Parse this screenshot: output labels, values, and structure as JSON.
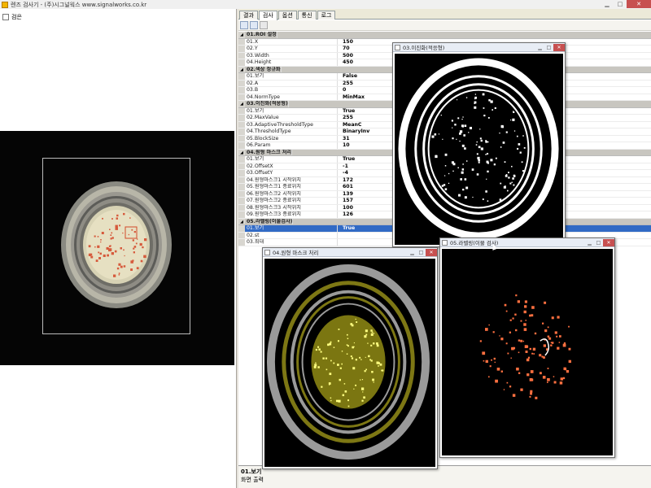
{
  "window": {
    "title": "렌즈 검사기 - (주)시그널웍스 www.signalworks.co.kr"
  },
  "left": {
    "checkbox_label": "검은"
  },
  "tabs": [
    "결과",
    "검사",
    "옵션",
    "통신",
    "로그"
  ],
  "property_grid": {
    "categories": [
      {
        "label": "01.ROI 설정",
        "rows": [
          {
            "name": "01.X",
            "value": "150"
          },
          {
            "name": "02.Y",
            "value": "70"
          },
          {
            "name": "03.Width",
            "value": "500"
          },
          {
            "name": "04.Height",
            "value": "450"
          }
        ]
      },
      {
        "label": "02.색상 정규화",
        "rows": [
          {
            "name": "01.보기",
            "value": "False"
          },
          {
            "name": "02.A",
            "value": "255"
          },
          {
            "name": "03.B",
            "value": "0"
          },
          {
            "name": "04.NormType",
            "value": "MinMax"
          }
        ]
      },
      {
        "label": "03.이진화(적응형)",
        "rows": [
          {
            "name": "01.보기",
            "value": "True"
          },
          {
            "name": "02.MaxValue",
            "value": "255"
          },
          {
            "name": "03.AdaptiveThresholdType",
            "value": "MeanC"
          },
          {
            "name": "04.ThresholdType",
            "value": "BinaryInv"
          },
          {
            "name": "05.BlockSize",
            "value": "31"
          },
          {
            "name": "06.Param",
            "value": "10"
          }
        ]
      },
      {
        "label": "04.원형 마스크 처리",
        "rows": [
          {
            "name": "01.보기",
            "value": "True"
          },
          {
            "name": "02.OffsetX",
            "value": "-1"
          },
          {
            "name": "03.OffsetY",
            "value": "-4"
          },
          {
            "name": "04.원형마스크1 시작위치",
            "value": "172"
          },
          {
            "name": "05.원형마스크1 종료위치",
            "value": "601"
          },
          {
            "name": "06.원형마스크2 시작위치",
            "value": "139"
          },
          {
            "name": "07.원형마스크2 종료위치",
            "value": "157"
          },
          {
            "name": "08.원형마스크3 시작위치",
            "value": "100"
          },
          {
            "name": "09.원형마스크3 종료위치",
            "value": "126"
          }
        ]
      },
      {
        "label": "05.라벨링(이물검사)",
        "rows": [
          {
            "name": "01.보기",
            "value": "True",
            "selected": true
          },
          {
            "name": "02.st",
            "value": ""
          },
          {
            "name": "03.최대",
            "value": ""
          }
        ]
      }
    ]
  },
  "description": {
    "title": "01.보기",
    "text": "화면 출력"
  },
  "windows": {
    "binarize": {
      "title": "03.이진화(적응형)"
    },
    "mask": {
      "title": "04.원형 마스크 처리"
    },
    "labeling": {
      "title": "05.라벨링(이물 검사)"
    }
  }
}
